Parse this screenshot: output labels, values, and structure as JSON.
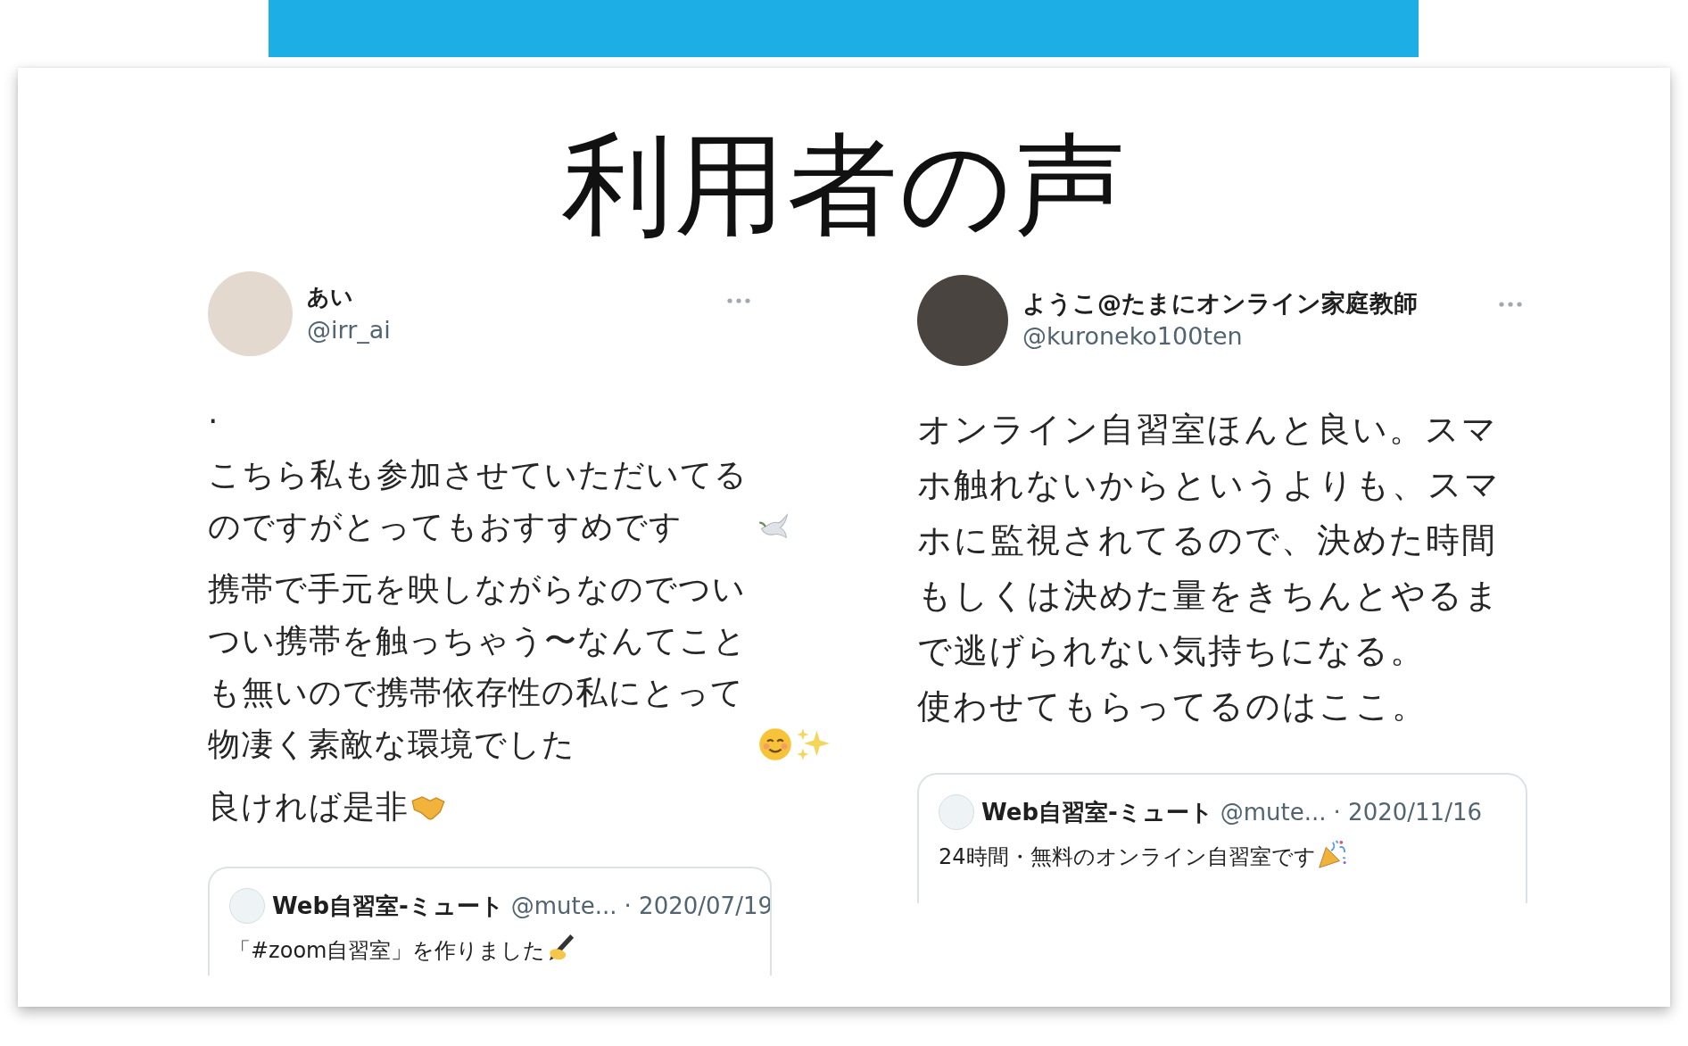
{
  "title": "利用者の声",
  "tweets": [
    {
      "author": "あい",
      "handle": "@irr_ai",
      "paragraphs": [
        ".",
        "こちら私も参加させていただいてるのですがとってもおすすめです",
        "携帯で手元を映しながらなのでついつい携帯を触っちゃう〜なんてことも無いので携帯依存性の私にとって物凄く素敵な環境でした",
        "良ければ是非"
      ],
      "quote": {
        "author": "Web自習室-ミュート",
        "handle": "@mute...",
        "date": "· 2020/07/19",
        "text": "「#zoom自習室」を作りました"
      }
    },
    {
      "author": "ようこ@たまにオンライン家庭教師",
      "handle": "@kuroneko100ten",
      "paragraphs": [
        "オンライン自習室ほんと良い。スマホ触れないからというよりも、スマホに監視されてるので、決めた時間もしくは決めた量をきちんとやるまで逃げられない気持ちになる。",
        "使わせてもらってるのはここ。"
      ],
      "quote": {
        "author": "Web自習室-ミュート",
        "handle": "@mute...",
        "date": "· 2020/11/16",
        "text": "24時間・無料のオンライン自習室です"
      }
    }
  ]
}
